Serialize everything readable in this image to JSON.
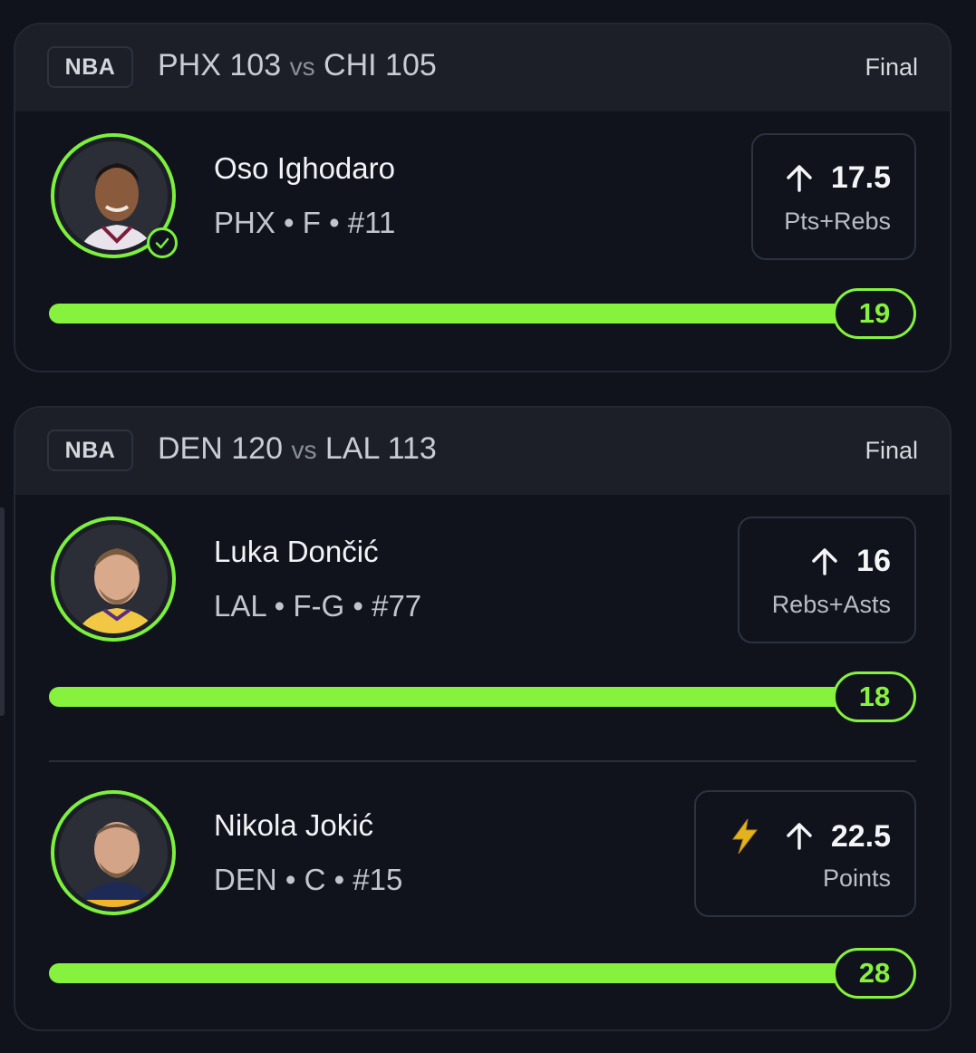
{
  "cards": [
    {
      "league": "NBA",
      "team1": "PHX",
      "score1": "103",
      "vs": "vs",
      "team2": "CHI",
      "score2": "105",
      "status": "Final",
      "players": [
        {
          "name": "Oso Ighodaro",
          "meta": "PHX • F • #11",
          "line": "17.5",
          "stat": "Pts+Rebs",
          "direction_icon": "arrow-up-icon",
          "result": "19",
          "progress": 1.0,
          "verified": true
        }
      ]
    },
    {
      "league": "NBA",
      "team1": "DEN",
      "score1": "120",
      "vs": "vs",
      "team2": "LAL",
      "score2": "113",
      "status": "Final",
      "players": [
        {
          "name": "Luka Dončić",
          "meta": "LAL • F-G • #77",
          "line": "16",
          "stat": "Rebs+Asts",
          "direction_icon": "arrow-up-icon",
          "result": "18",
          "progress": 1.0
        },
        {
          "name": "Nikola Jokić",
          "meta": "DEN • C • #15",
          "line": "22.5",
          "stat": "Points",
          "direction_icon": "arrow-up-icon",
          "boost_icon": "lightning-bolt-icon",
          "result": "28",
          "progress": 1.0
        }
      ]
    }
  ],
  "colors": {
    "accent": "#86f23e",
    "background": "#10131c",
    "header": "#1c1f28",
    "boost": "#e2b21f"
  }
}
